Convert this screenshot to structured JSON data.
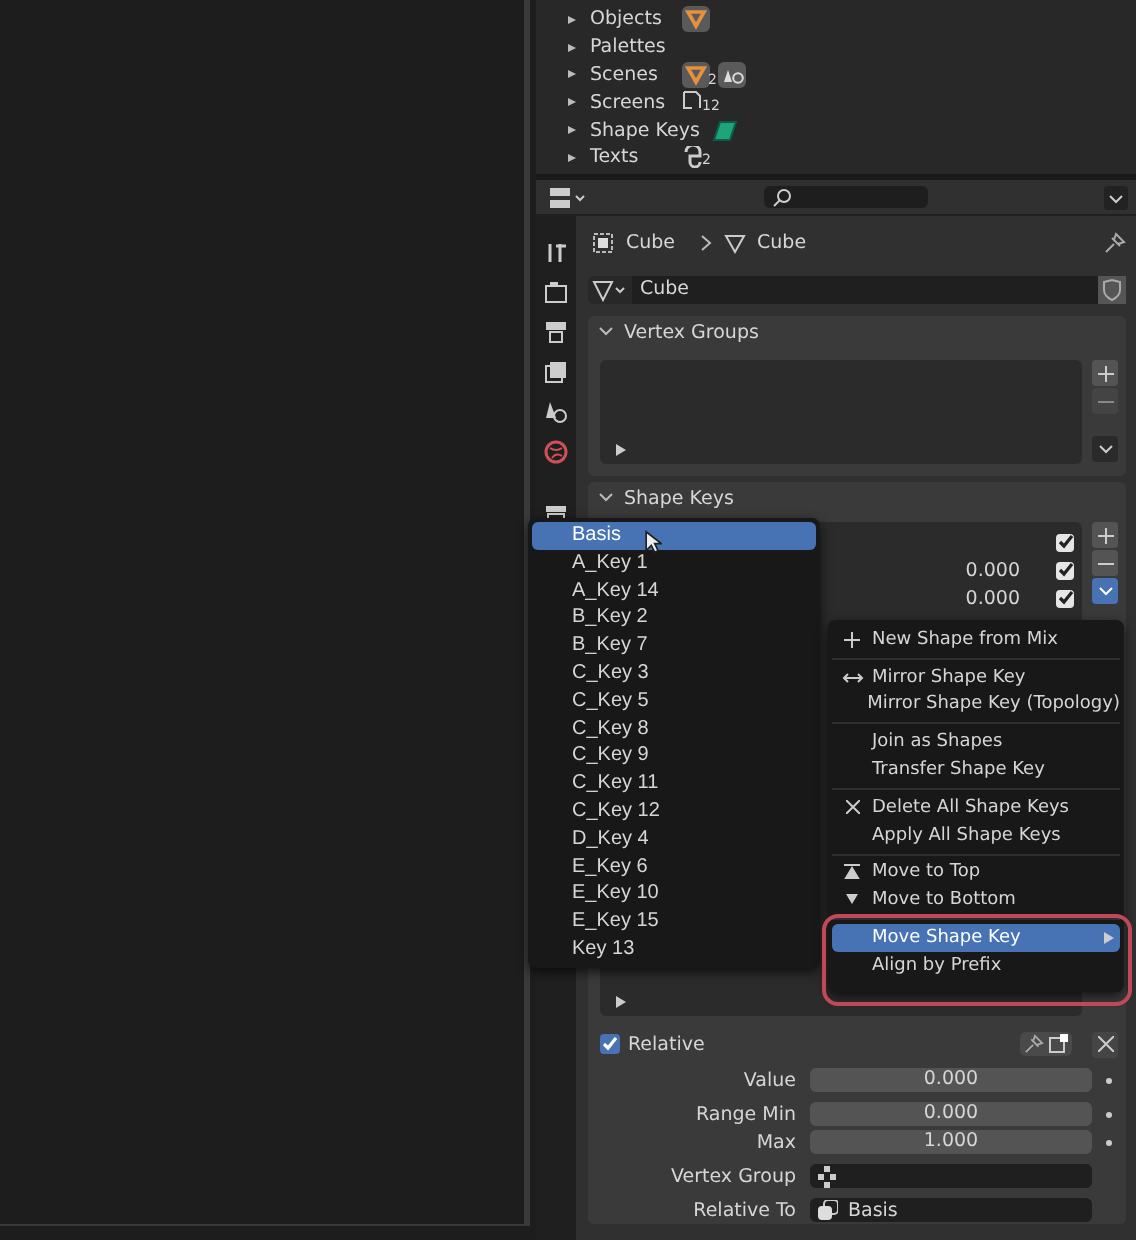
{
  "outliner": {
    "items": [
      {
        "label": "Objects",
        "icons": [
          {
            "kind": "mesh-object"
          }
        ]
      },
      {
        "label": "Palettes"
      },
      {
        "label": "Scenes",
        "icons": [
          {
            "kind": "mesh-object",
            "count": "2"
          },
          {
            "kind": "scene"
          }
        ]
      },
      {
        "label": "Screens",
        "icons": [
          {
            "kind": "screen",
            "count": "12"
          }
        ]
      },
      {
        "label": "Shape Keys",
        "icons": [
          {
            "kind": "shape-key"
          }
        ]
      },
      {
        "label": "Texts",
        "icons": [
          {
            "kind": "text",
            "count": "2"
          }
        ]
      }
    ]
  },
  "properties": {
    "breadcrumb": [
      "Cube",
      "Cube"
    ],
    "mesh_name": "Cube",
    "vertex_groups": {
      "title": "Vertex Groups"
    },
    "shape_keys": {
      "title": "Shape Keys",
      "rows": [
        {
          "checked": true
        },
        {
          "value": "0.000",
          "checked": true
        },
        {
          "value": "0.000",
          "checked": true
        }
      ],
      "relative": {
        "label": "Relative",
        "checked": true
      },
      "fields": [
        {
          "kind": "number",
          "label": "Value",
          "value": "0.000"
        },
        {
          "kind": "number",
          "label": "Range Min",
          "value": "0.000"
        },
        {
          "kind": "number",
          "label": "Max",
          "value": "1.000"
        },
        {
          "kind": "vertex-group",
          "label": "Vertex Group"
        },
        {
          "kind": "shape",
          "label": "Relative To",
          "value": "Basis"
        }
      ]
    }
  },
  "dropdown": {
    "items": [
      {
        "label": "Basis",
        "selected": true
      },
      {
        "label": "A_Key 1",
        "selected": false
      },
      {
        "label": "A_Key 14",
        "selected": false
      },
      {
        "label": "B_Key 2",
        "selected": false
      },
      {
        "label": "B_Key 7",
        "selected": false
      },
      {
        "label": "C_Key 3",
        "selected": false
      },
      {
        "label": "C_Key 5",
        "selected": false
      },
      {
        "label": "C_Key 8",
        "selected": false
      },
      {
        "label": "C_Key 9",
        "selected": false
      },
      {
        "label": "C_Key 11",
        "selected": false
      },
      {
        "label": "C_Key 12",
        "selected": false
      },
      {
        "label": "D_Key 4",
        "selected": false
      },
      {
        "label": "E_Key 6",
        "selected": false
      },
      {
        "label": "E_Key 10",
        "selected": false
      },
      {
        "label": "E_Key 15",
        "selected": false
      },
      {
        "label": "Key 13",
        "selected": false
      }
    ]
  },
  "context_menu": {
    "sections": [
      [
        {
          "kind": "add",
          "label": "New Shape from Mix",
          "selected": false,
          "submenu": false
        }
      ],
      [
        {
          "kind": "mirror",
          "label": "Mirror Shape Key",
          "selected": false,
          "submenu": false
        },
        {
          "label": "Mirror Shape Key (Topology)",
          "selected": false,
          "submenu": false
        }
      ],
      [
        {
          "label": "Join as Shapes",
          "selected": false,
          "submenu": false
        },
        {
          "label": "Transfer Shape Key",
          "selected": false,
          "submenu": false
        }
      ],
      [
        {
          "kind": "delete",
          "label": "Delete All Shape Keys",
          "selected": false,
          "submenu": false
        },
        {
          "label": "Apply All Shape Keys",
          "selected": false,
          "submenu": false
        }
      ],
      [
        {
          "kind": "top",
          "label": "Move to Top",
          "selected": false,
          "submenu": false
        },
        {
          "kind": "bottom",
          "label": "Move to Bottom",
          "selected": false,
          "submenu": false
        }
      ],
      [
        {
          "label": "Move Shape Key",
          "selected": true,
          "submenu": true
        },
        {
          "label": "Align by Prefix",
          "selected": false,
          "submenu": false
        }
      ]
    ]
  }
}
